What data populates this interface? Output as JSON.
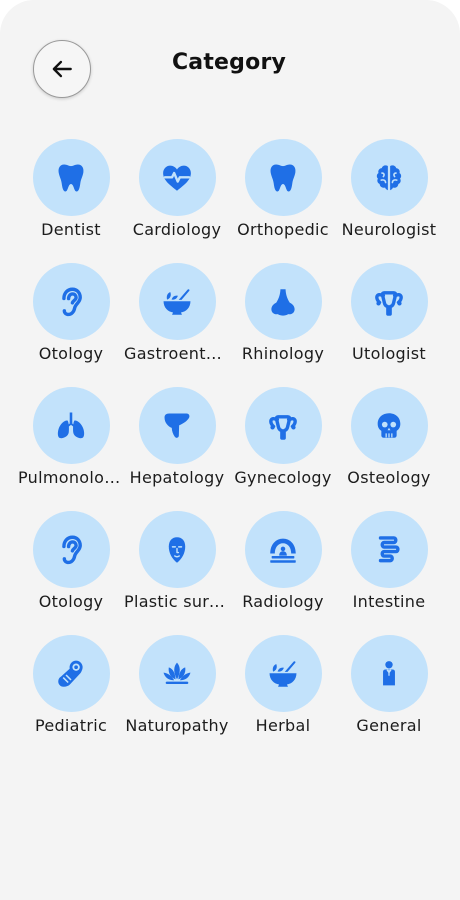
{
  "header": {
    "title": "Category",
    "back_icon": "arrow-left-icon"
  },
  "colors": {
    "background": "#f4f4f4",
    "icon_circle": "#c2e2fb",
    "icon": "#1f6fe6"
  },
  "categories": [
    {
      "label": "Dentist",
      "icon": "tooth-icon"
    },
    {
      "label": "Cardiology",
      "icon": "heart-pulse-icon"
    },
    {
      "label": "Orthopedic",
      "icon": "tooth-icon"
    },
    {
      "label": "Neurologist",
      "icon": "brain-icon"
    },
    {
      "label": "Otology",
      "icon": "ear-icon"
    },
    {
      "label": "Gastroenterology",
      "icon": "mortar-pestle-icon"
    },
    {
      "label": "Rhinology",
      "icon": "nose-icon"
    },
    {
      "label": "Utologist",
      "icon": "uterus-icon"
    },
    {
      "label": "Pulmonology",
      "icon": "lungs-icon"
    },
    {
      "label": "Hepatology",
      "icon": "liver-icon"
    },
    {
      "label": "Gynecology",
      "icon": "uterus-icon"
    },
    {
      "label": "Osteology",
      "icon": "skull-icon"
    },
    {
      "label": "Otology",
      "icon": "ear-icon"
    },
    {
      "label": "Plastic surgery",
      "icon": "face-icon"
    },
    {
      "label": "Radiology",
      "icon": "xray-machine-icon"
    },
    {
      "label": "Intestine",
      "icon": "intestine-icon"
    },
    {
      "label": "Pediatric",
      "icon": "baby-icon"
    },
    {
      "label": "Naturopathy",
      "icon": "lotus-icon"
    },
    {
      "label": "Herbal",
      "icon": "mortar-pestle-icon"
    },
    {
      "label": "General",
      "icon": "doctor-icon"
    }
  ]
}
